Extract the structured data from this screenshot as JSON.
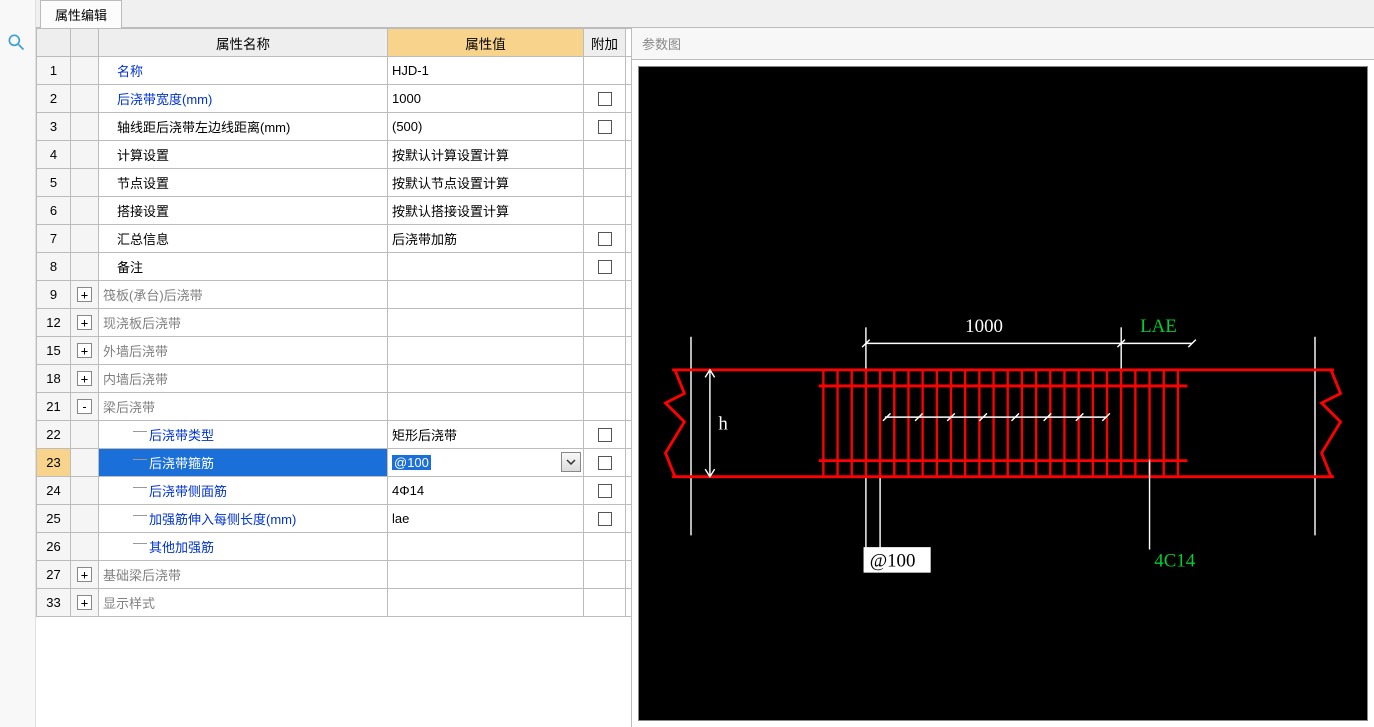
{
  "tab_title": "属性编辑",
  "headers": {
    "name": "属性名称",
    "value": "属性值",
    "extra": "附加"
  },
  "diagram_title": "参数图",
  "rows": [
    {
      "n": "1",
      "toggle": "",
      "name": "名称",
      "cls": "blue-text indent1",
      "val": "HJD-1",
      "chk": false
    },
    {
      "n": "2",
      "toggle": "",
      "name": "后浇带宽度(mm)",
      "cls": "blue-text indent1",
      "val": "1000",
      "chk": true
    },
    {
      "n": "3",
      "toggle": "",
      "name": "轴线距后浇带左边线距离(mm)",
      "cls": "black-text indent1",
      "val": "(500)",
      "chk": true
    },
    {
      "n": "4",
      "toggle": "",
      "name": "计算设置",
      "cls": "black-text indent1",
      "val": "按默认计算设置计算",
      "chk": false
    },
    {
      "n": "5",
      "toggle": "",
      "name": "节点设置",
      "cls": "black-text indent1",
      "val": "按默认节点设置计算",
      "chk": false
    },
    {
      "n": "6",
      "toggle": "",
      "name": "搭接设置",
      "cls": "black-text indent1",
      "val": "按默认搭接设置计算",
      "chk": false
    },
    {
      "n": "7",
      "toggle": "",
      "name": "汇总信息",
      "cls": "black-text indent1",
      "val": "后浇带加筋",
      "chk": true
    },
    {
      "n": "8",
      "toggle": "",
      "name": "备注",
      "cls": "black-text indent1",
      "val": "",
      "chk": true
    },
    {
      "n": "9",
      "toggle": "+",
      "name": "筏板(承台)后浇带",
      "cls": "gray-text",
      "val": "",
      "chk": false
    },
    {
      "n": "12",
      "toggle": "+",
      "name": "现浇板后浇带",
      "cls": "gray-text",
      "val": "",
      "chk": false
    },
    {
      "n": "15",
      "toggle": "+",
      "name": "外墙后浇带",
      "cls": "gray-text",
      "val": "",
      "chk": false
    },
    {
      "n": "18",
      "toggle": "+",
      "name": "内墙后浇带",
      "cls": "gray-text",
      "val": "",
      "chk": false
    },
    {
      "n": "21",
      "toggle": "-",
      "name": "梁后浇带",
      "cls": "gray-text",
      "val": "",
      "chk": false
    },
    {
      "n": "22",
      "toggle": "",
      "name": "后浇带类型",
      "cls": "blue-text indent2 child",
      "val": "矩形后浇带",
      "chk": true
    },
    {
      "n": "23",
      "toggle": "",
      "name": "后浇带箍筋",
      "cls": "blue-text indent2 child",
      "val": "@100",
      "chk": true,
      "selected": true,
      "combo": true
    },
    {
      "n": "24",
      "toggle": "",
      "name": "后浇带侧面筋",
      "cls": "blue-text indent2 child",
      "val": "4Φ14",
      "chk": true
    },
    {
      "n": "25",
      "toggle": "",
      "name": "加强筋伸入每侧长度(mm)",
      "cls": "blue-text indent2 child",
      "val": "lae",
      "chk": true
    },
    {
      "n": "26",
      "toggle": "",
      "name": "其他加强筋",
      "cls": "blue-text indent2 child last",
      "val": "",
      "chk": false
    },
    {
      "n": "27",
      "toggle": "+",
      "name": "基础梁后浇带",
      "cls": "gray-text",
      "val": "",
      "chk": false
    },
    {
      "n": "33",
      "toggle": "+",
      "name": "显示样式",
      "cls": "gray-text",
      "val": "",
      "chk": false
    }
  ],
  "diagram": {
    "width_label": "1000",
    "lae_label": "LAE",
    "h_label": "h",
    "spacing_label": "@100",
    "rebar_label": "4C14"
  }
}
